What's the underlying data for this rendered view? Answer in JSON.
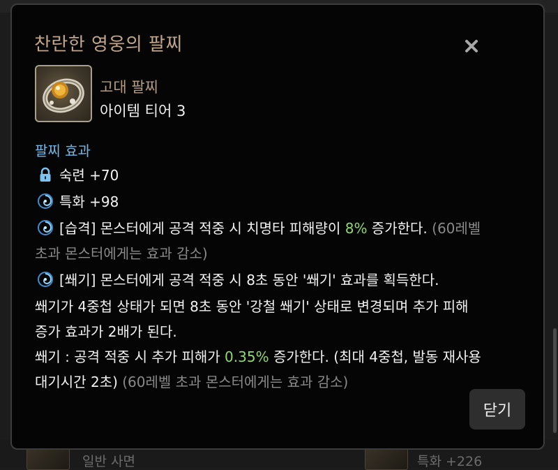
{
  "dialog": {
    "title": "찬란한 영웅의 팔찌",
    "item_type": "고대 팔찌",
    "item_tier": "아이템 티어 3",
    "effects_header": "팔찌 효과",
    "close_button_label": "닫기",
    "close_icon": "close-icon"
  },
  "effects": [
    {
      "icon": "lock-icon",
      "text": "숙련 +70"
    },
    {
      "icon": "swirl-icon",
      "text": "특화 +98"
    }
  ],
  "effect_3": {
    "icon": "swirl-icon",
    "part1": "[습격] 몬스터에게 공격 적중 시 치명타 피해량이 ",
    "highlight": "8%",
    "part2": " 증가한다. ",
    "note1": "(60레벨",
    "note2": "초과 몬스터에게는 효과 감소)"
  },
  "effect_4": {
    "icon": "swirl-icon",
    "line1": "[쐐기] 몬스터에게 공격 적중 시 8초 동안 '쐐기' 효과를 획득한다.",
    "line2": "쐐기가 4중첩 상태가 되면 8초 동안 '강철 쐐기' 상태로 변경되며 추가 피해",
    "line3": "증가 효과가 2배가 된다.",
    "line4_part1": "쐐기 : 공격 적중 시 추가 피해가 ",
    "line4_highlight": "0.35%",
    "line4_part2": " 증가한다. (최대 4중첩, 발동 재사용",
    "line5_part1": "대기시간 2초) ",
    "line5_note": "(60레벨 초과 몬스터에게는 효과 감소)"
  },
  "background": {
    "bottom_text_left": "일반 사면",
    "bottom_text_right": "특화 +226"
  },
  "colors": {
    "title": "#bfa58a",
    "effects_header": "#6fb8e8",
    "highlight": "#8fd96f",
    "note": "#8a8a8a"
  }
}
